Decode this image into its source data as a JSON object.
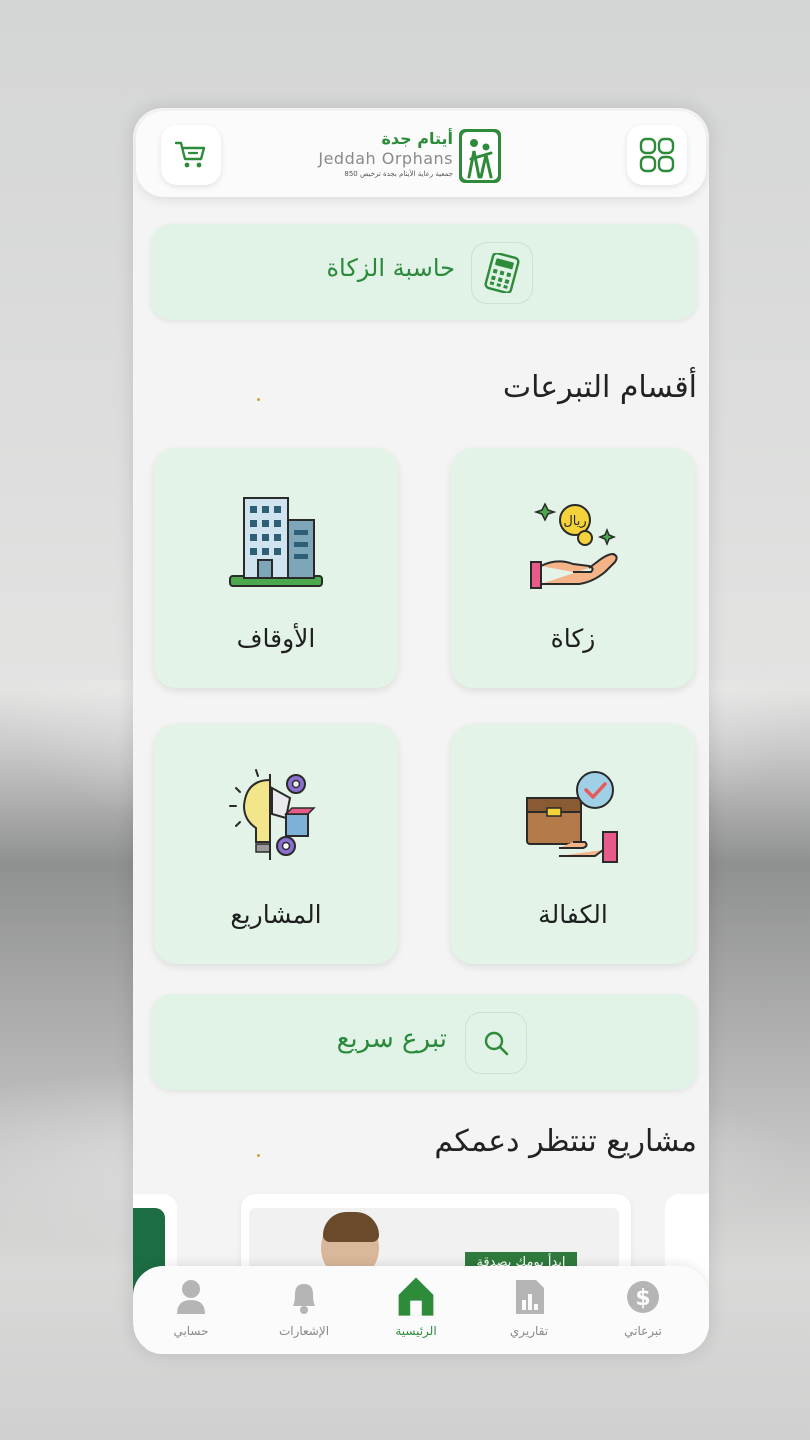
{
  "header": {
    "logo_ar": "أيتام جدة",
    "logo_en": "Jeddah Orphans",
    "logo_sub": "جمعية رعاية الأيتام بجدة ترخيص 850",
    "cart_icon": "cart-icon",
    "menu_icon": "grid-menu-icon"
  },
  "zakat_calculator": {
    "label": "حاسبة الزكاة",
    "icon": "calculator-icon"
  },
  "donation_sections": {
    "title": "أقسام التبرعات",
    "items": [
      {
        "label": "زكاة",
        "icon": "coin-hand-icon"
      },
      {
        "label": "الأوقاف",
        "icon": "building-icon"
      },
      {
        "label": "الكفالة",
        "icon": "box-hand-check-icon"
      },
      {
        "label": "المشاريع",
        "icon": "idea-gears-icon"
      }
    ]
  },
  "quick_donate": {
    "label": "تبرع سريع",
    "icon": "search-icon"
  },
  "projects": {
    "title": "مشاريع تنتظر دعمكم",
    "banner_text": "ابدأ يومك بصدقة"
  },
  "bottom_nav": {
    "items": [
      {
        "label": "حسابي",
        "icon": "user-icon"
      },
      {
        "label": "الإشعارات",
        "icon": "bell-icon"
      },
      {
        "label": "الرئيسية",
        "icon": "home-icon"
      },
      {
        "label": "تقاريري",
        "icon": "report-icon"
      },
      {
        "label": "تبرعاتي",
        "icon": "dollar-icon"
      }
    ],
    "active": "الرئيسية"
  },
  "colors": {
    "brand_green": "#2e8b3a",
    "card_bg": "#e3f3e8",
    "nav_inactive": "#8a8a8a"
  }
}
